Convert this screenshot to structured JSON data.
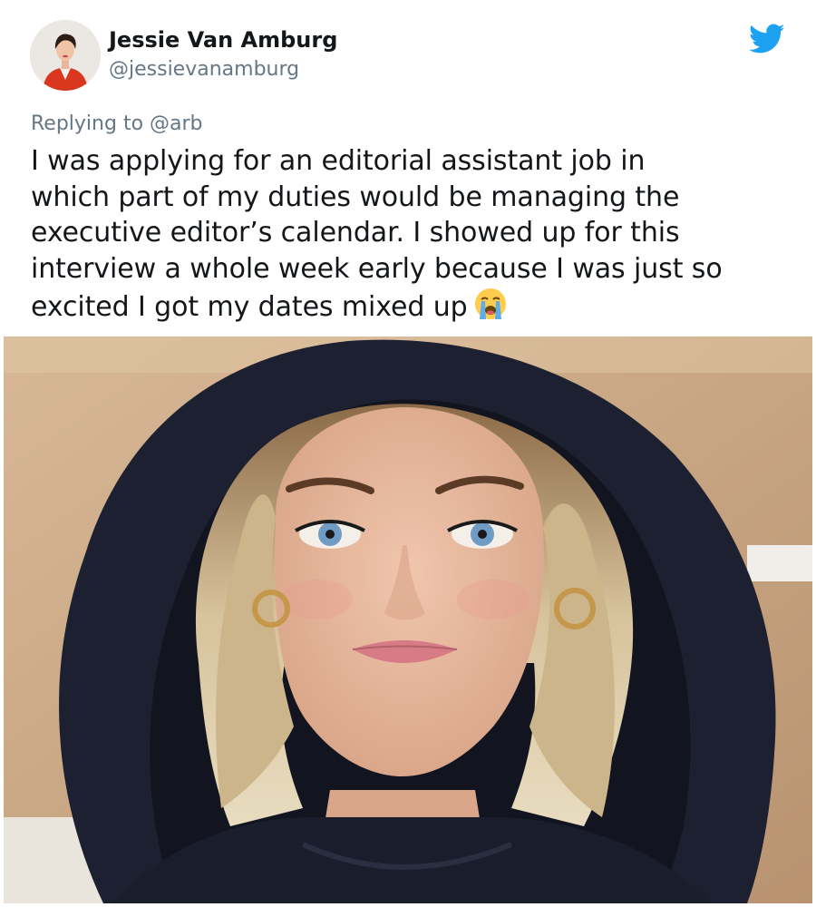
{
  "tweet": {
    "author": {
      "display_name": "Jessie Van Amburg",
      "handle": "@jessievanamburg",
      "avatar_icon": "profile-photo"
    },
    "platform_icon": "twitter-bird-icon",
    "reply": {
      "prefix": "Replying to ",
      "mention": "@arb"
    },
    "text_lines": [
      "I was applying for an editorial assistant job in",
      "which part of my duties would be managing the",
      "executive editor’s calendar. I showed up for this",
      "interview a whole week early because I was just so",
      "excited I got my dates mixed up"
    ],
    "emoji": "loudly-crying-face",
    "media": {
      "type": "photo",
      "subject": "selfie-person-in-black-hoodie"
    }
  },
  "colors": {
    "twitter_blue": "#1da1f2",
    "text_primary": "#14171a",
    "text_secondary": "#657786",
    "background": "#ffffff"
  }
}
